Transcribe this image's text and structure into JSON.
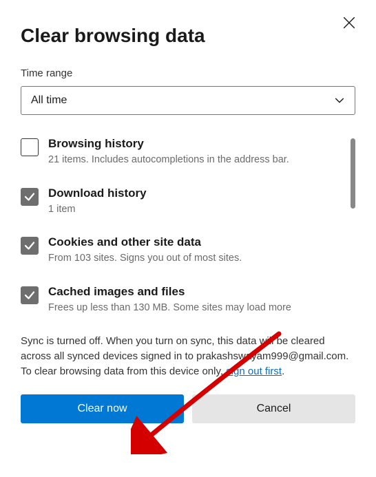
{
  "title": "Clear browsing data",
  "time_range": {
    "label": "Time range",
    "selected": "All time"
  },
  "options": [
    {
      "title": "Browsing history",
      "desc": "21 items. Includes autocompletions in the address bar.",
      "checked": false
    },
    {
      "title": "Download history",
      "desc": "1 item",
      "checked": true
    },
    {
      "title": "Cookies and other site data",
      "desc": "From 103 sites. Signs you out of most sites.",
      "checked": true
    },
    {
      "title": "Cached images and files",
      "desc": "Frees up less than 130 MB. Some sites may load more",
      "checked": true
    }
  ],
  "sync_note": {
    "part1": "Sync is turned off. When you turn on sync, this data will be cleared across all synced devices signed in to prakashswayam999@gmail.com. To clear browsing data from this device only, ",
    "link": "sign out first",
    "part2": "."
  },
  "buttons": {
    "primary": "Clear now",
    "secondary": "Cancel"
  }
}
